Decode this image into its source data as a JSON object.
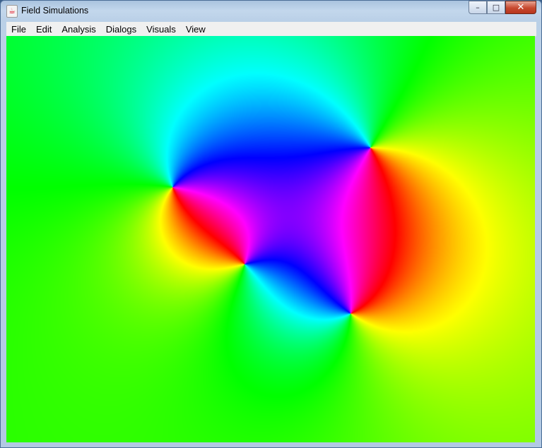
{
  "window": {
    "title": "Field Simulations",
    "app_icon": "java-cup-icon",
    "controls": {
      "minimize": "–",
      "maximize": "□",
      "close": "✕"
    }
  },
  "menubar": {
    "items": [
      "File",
      "Edit",
      "Analysis",
      "Dialogs",
      "Visuals",
      "View"
    ]
  },
  "visualization": {
    "type": "phase-field color plot"
  }
}
